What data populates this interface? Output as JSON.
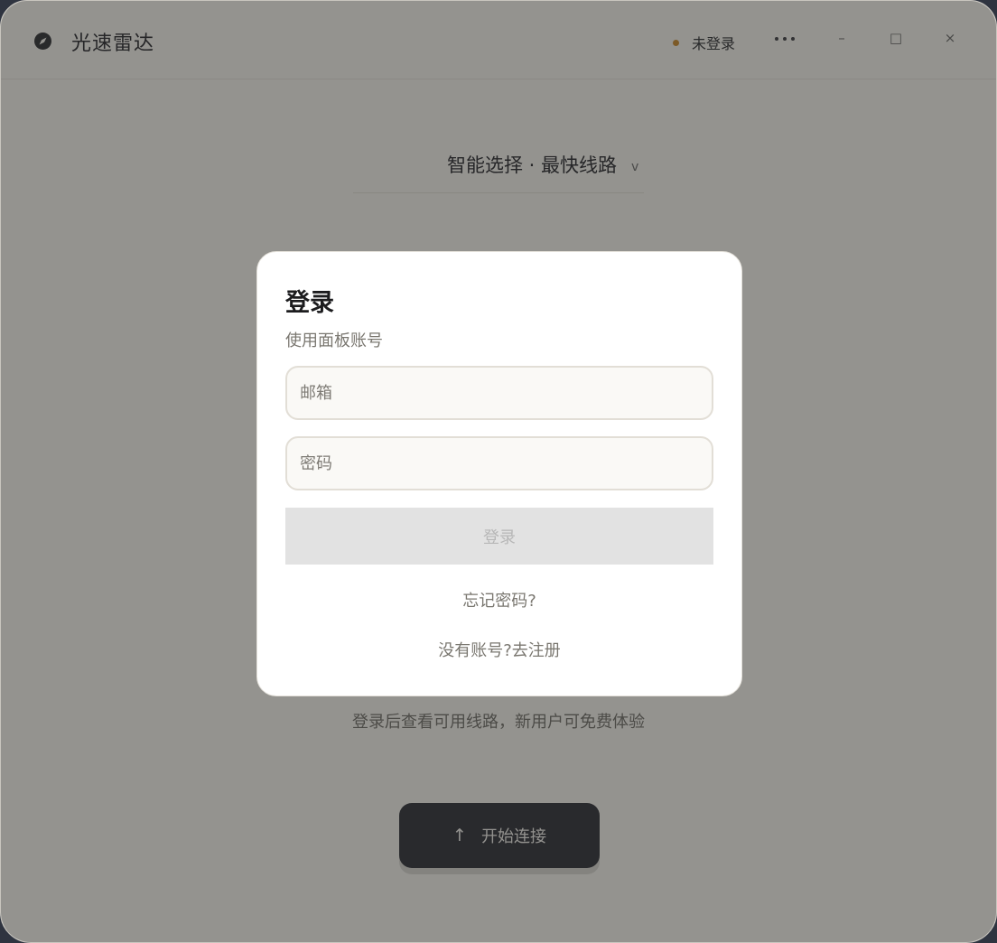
{
  "app": {
    "title": "光速雷达",
    "logo_icon": "compass-icon"
  },
  "header": {
    "status_label": "未登录",
    "status_color": "#c9892a",
    "more_icon": "more-horizontal-icon",
    "minimize_glyph": "–",
    "maximize_glyph": "□",
    "close_glyph": "×"
  },
  "route": {
    "label": "智能选择 · 最快线路",
    "chevron": "v"
  },
  "main": {
    "hint": "登录后查看可用线路，新用户可免费体验",
    "connect_arrow": "↑",
    "connect_label": "开始连接"
  },
  "login_dialog": {
    "title": "登录",
    "subtitle": "使用面板账号",
    "email_placeholder": "邮箱",
    "password_placeholder": "密码",
    "submit_label": "登录",
    "forgot_label": "忘记密码?",
    "register_prompt": "没有账号?",
    "register_link": "去注册"
  },
  "colors": {
    "accent_dark": "#2b2d35",
    "background": "#f7f5f0",
    "status_dot": "#c9892a"
  }
}
